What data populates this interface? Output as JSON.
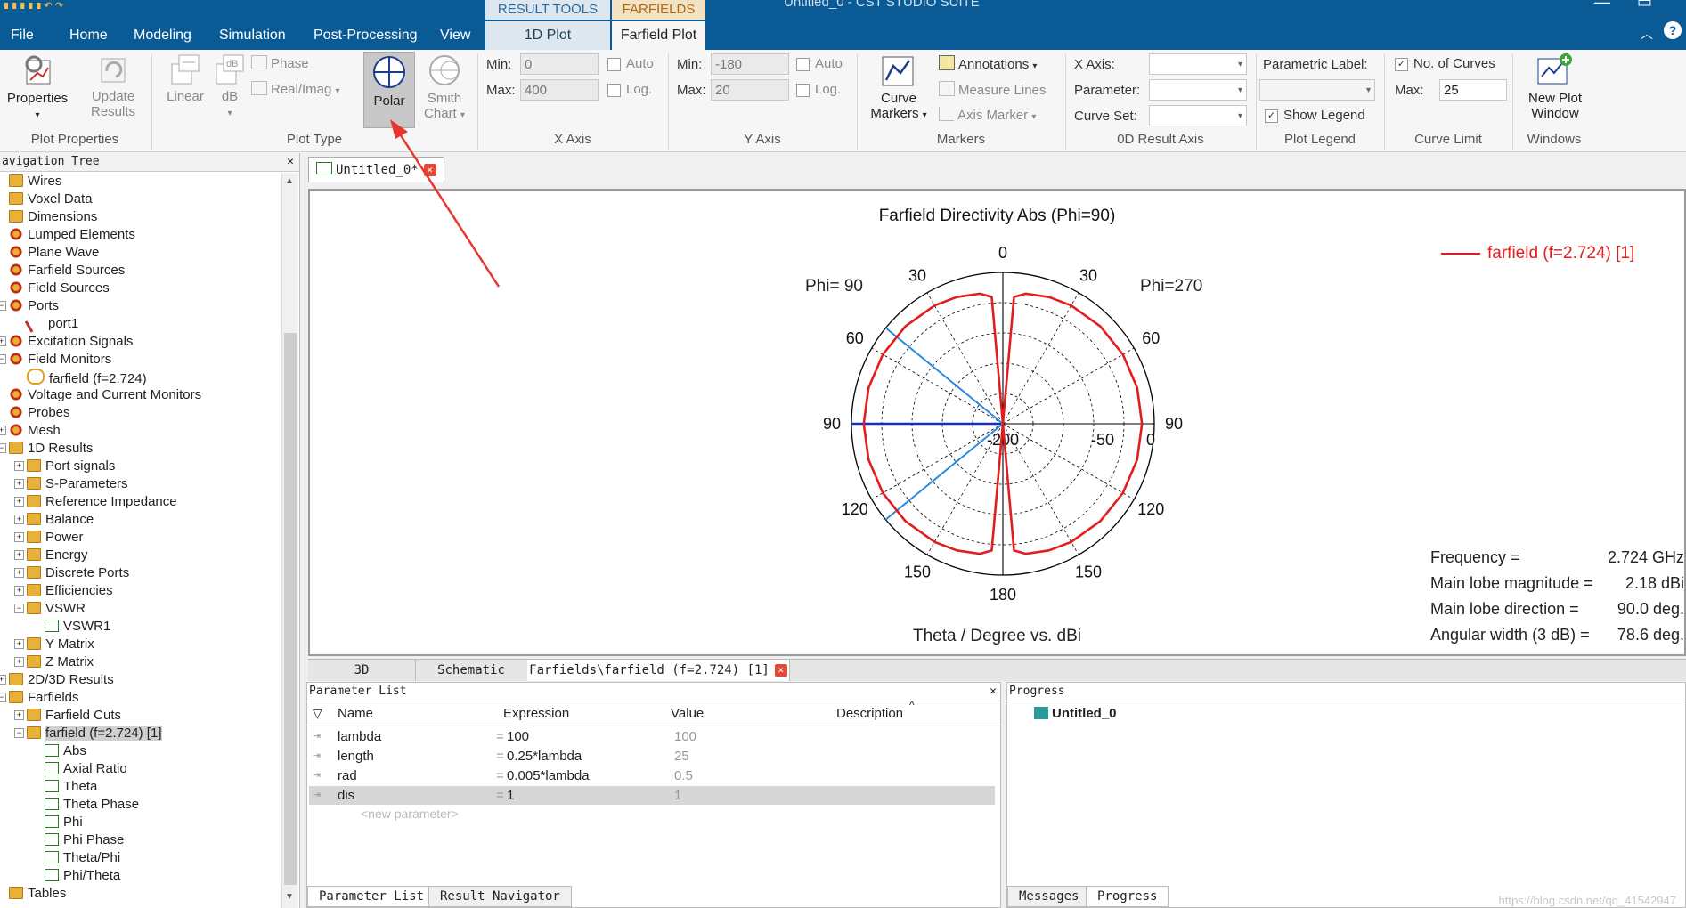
{
  "window": {
    "title": "Untitled_0 - CST STUDIO SUITE"
  },
  "context_groups": [
    {
      "name": "RESULT TOOLS"
    },
    {
      "name": "FARFIELDS"
    }
  ],
  "menu_tabs": [
    "File",
    "Home",
    "Modeling",
    "Simulation",
    "Post-Processing",
    "View",
    "1D Plot",
    "Farfield Plot"
  ],
  "ribbon": {
    "plot_properties": {
      "properties": "Properties",
      "update": "Update",
      "results": "Results",
      "group": "Plot Properties"
    },
    "plot_type": {
      "linear": "Linear",
      "db": "dB",
      "phase": "Phase",
      "realimag": "Real/Imag",
      "polar": "Polar",
      "smith1": "Smith",
      "smith2": "Chart",
      "group": "Plot Type"
    },
    "x_axis": {
      "min_label": "Min:",
      "min": "0",
      "max_label": "Max:",
      "max": "400",
      "auto": "Auto",
      "log": "Log.",
      "group": "X Axis"
    },
    "y_axis": {
      "min_label": "Min:",
      "min": "-180",
      "max_label": "Max:",
      "max": "20",
      "auto": "Auto",
      "log": "Log.",
      "group": "Y Axis"
    },
    "markers": {
      "curve1": "Curve",
      "curve2": "Markers",
      "annotations": "Annotations",
      "measure": "Measure Lines",
      "axis_marker": "Axis Marker",
      "group": "Markers"
    },
    "od_axis": {
      "xaxis": "X Axis:",
      "parameter": "Parameter:",
      "curveset": "Curve Set:",
      "group": "0D Result Axis"
    },
    "legend": {
      "param_label": "Parametric Label:",
      "show_legend": "Show Legend",
      "group": "Plot Legend"
    },
    "curve_limit": {
      "no_curves": "No. of Curves",
      "max_label": "Max:",
      "max": "25",
      "group": "Curve Limit"
    },
    "windows": {
      "new1": "New Plot",
      "new2": "Window",
      "group": "Windows"
    }
  },
  "nav": {
    "title": "avigation Tree",
    "items": [
      {
        "label": "Wires",
        "icon": "folder-gold"
      },
      {
        "label": "Voxel Data",
        "icon": "folder-gold"
      },
      {
        "label": "Dimensions",
        "icon": "folder-gold"
      },
      {
        "label": "Lumped Elements",
        "icon": "gear"
      },
      {
        "label": "Plane Wave",
        "icon": "gear"
      },
      {
        "label": "Farfield Sources",
        "icon": "gear"
      },
      {
        "label": "Field Sources",
        "icon": "gear"
      },
      {
        "label": "Ports",
        "icon": "gear"
      },
      {
        "label": "port1",
        "icon": "port"
      },
      {
        "label": "Excitation Signals",
        "icon": "gear"
      },
      {
        "label": "Field Monitors",
        "icon": "gear"
      },
      {
        "label": "farfield (f=2.724)",
        "icon": "farfield"
      },
      {
        "label": "Voltage and Current Monitors",
        "icon": "gear"
      },
      {
        "label": "Probes",
        "icon": "gear"
      },
      {
        "label": "Mesh",
        "icon": "gear"
      },
      {
        "label": "1D Results",
        "icon": "folder"
      },
      {
        "label": "Port signals",
        "icon": "folder"
      },
      {
        "label": "S-Parameters",
        "icon": "folder"
      },
      {
        "label": "Reference Impedance",
        "icon": "folder"
      },
      {
        "label": "Balance",
        "icon": "folder"
      },
      {
        "label": "Power",
        "icon": "folder"
      },
      {
        "label": "Energy",
        "icon": "folder"
      },
      {
        "label": "Discrete Ports",
        "icon": "folder"
      },
      {
        "label": "Efficiencies",
        "icon": "folder"
      },
      {
        "label": "VSWR",
        "icon": "folder"
      },
      {
        "label": "VSWR1",
        "icon": "plot"
      },
      {
        "label": "Y Matrix",
        "icon": "folder"
      },
      {
        "label": "Z Matrix",
        "icon": "folder"
      },
      {
        "label": "2D/3D Results",
        "icon": "folder"
      },
      {
        "label": "Farfields",
        "icon": "folder"
      },
      {
        "label": "Farfield Cuts",
        "icon": "folder"
      },
      {
        "label": "farfield (f=2.724) [1]",
        "icon": "folder"
      },
      {
        "label": "Abs",
        "icon": "plot"
      },
      {
        "label": "Axial Ratio",
        "icon": "plot"
      },
      {
        "label": "Theta",
        "icon": "plot"
      },
      {
        "label": "Theta Phase",
        "icon": "plot"
      },
      {
        "label": "Phi",
        "icon": "plot"
      },
      {
        "label": "Phi Phase",
        "icon": "plot"
      },
      {
        "label": "Theta/Phi",
        "icon": "plot"
      },
      {
        "label": "Phi/Theta",
        "icon": "plot"
      },
      {
        "label": "Tables",
        "icon": "folder"
      }
    ]
  },
  "doc_tab": {
    "label": "Untitled_0*"
  },
  "plot": {
    "title": "Farfield Directivity Abs (Phi=90)",
    "left_label": "Phi= 90",
    "right_label": "Phi=270",
    "xlabel": "Theta / Degree vs. dBi",
    "legend": "farfield (f=2.724) [1]",
    "info": [
      {
        "k": "Frequency =",
        "v": "2.724 GHz"
      },
      {
        "k": "Main lobe magnitude =",
        "v": "2.18 dBi"
      },
      {
        "k": "Main lobe direction =",
        "v": "90.0 deg."
      },
      {
        "k": "Angular width (3 dB) =",
        "v": "78.6 deg."
      }
    ],
    "angle_labels": [
      "0",
      "30",
      "60",
      "90",
      "120",
      "150",
      "180",
      "150",
      "120",
      "90",
      "60",
      "30"
    ],
    "radial_labels": [
      "-200",
      "-50",
      "0"
    ]
  },
  "chart_data": {
    "type": "polar",
    "title": "Farfield Directivity Abs (Phi=90)",
    "xlabel": "Theta / Degree vs. dBi",
    "legend": "farfield (f=2.724) [1]",
    "rlim": [
      -200,
      20
    ],
    "series": [
      {
        "name": "farfield (f=2.724) [1]",
        "color": "#e21d1d",
        "theta": [
          0,
          5,
          10,
          20,
          30,
          45,
          60,
          75,
          90,
          105,
          120,
          135,
          150,
          160,
          170,
          175,
          180
        ],
        "r": [
          -200,
          -15,
          -8,
          -4,
          -1.5,
          0.3,
          1.4,
          2.0,
          2.18,
          2.0,
          1.4,
          0.3,
          -1.5,
          -4,
          -8,
          -15,
          -200
        ]
      }
    ],
    "markers": [
      {
        "name": "main-lobe",
        "theta": 90,
        "color": "#1230c8"
      },
      {
        "name": "3dB-upper",
        "theta": 50.7,
        "color": "#2d8ae0"
      },
      {
        "name": "3dB-lower",
        "theta": 129.3,
        "color": "#2d8ae0"
      }
    ]
  },
  "bottom_tabs": [
    "3D",
    "Schematic",
    "Farfields\\farfield (f=2.724) [1]"
  ],
  "params": {
    "title": "Parameter List",
    "headers": [
      "Name",
      "Expression",
      "Value",
      "Description"
    ],
    "rows": [
      {
        "name": "lambda",
        "expr": "100",
        "value": "100"
      },
      {
        "name": "length",
        "expr": "0.25*lambda",
        "value": "25"
      },
      {
        "name": "rad",
        "expr": "0.005*lambda",
        "value": "0.5"
      },
      {
        "name": "dis",
        "expr": "1",
        "value": "1"
      }
    ],
    "new_param": "<new parameter>",
    "tabs": [
      "Parameter List",
      "Result Navigator"
    ]
  },
  "progress": {
    "title": "Progress",
    "item": "Untitled_0",
    "tabs": [
      "Messages",
      "Progress"
    ]
  },
  "watermark": "https://blog.csdn.net/qq_41542947",
  "colors": {
    "title_bar": "#0a5a95",
    "curve": "#e21d1d",
    "arrow": "#e8362f"
  }
}
